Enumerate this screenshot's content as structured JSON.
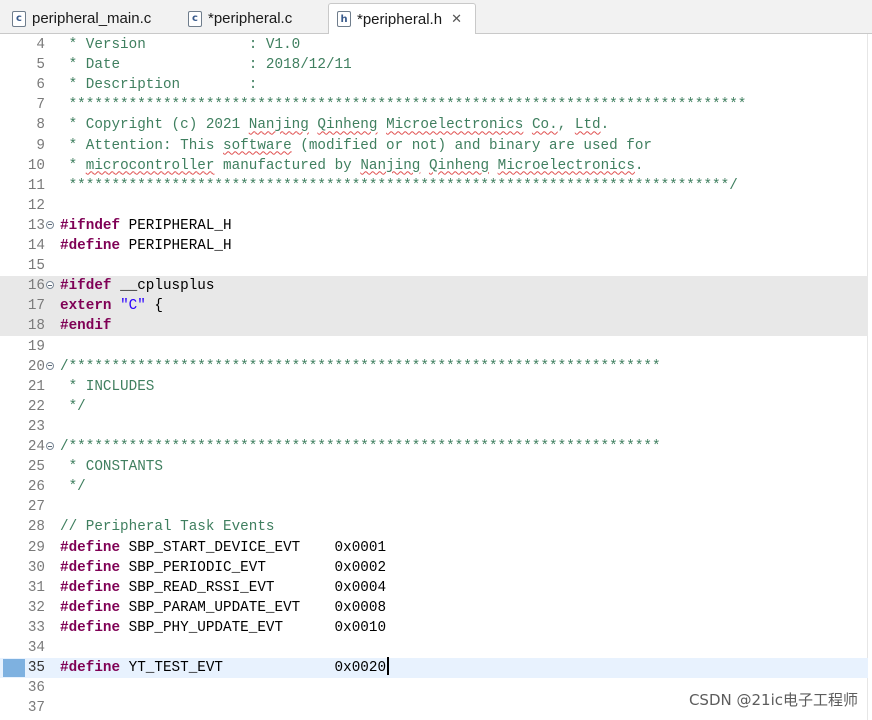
{
  "tabs": [
    {
      "label": "peripheral_main.c",
      "icon": "c-file-icon",
      "icon_text": "c",
      "active": false
    },
    {
      "label": "*peripheral.c",
      "icon": "c-file-icon",
      "icon_text": "c",
      "active": false
    },
    {
      "label": "*peripheral.h",
      "icon": "h-file-icon",
      "icon_text": "h",
      "active": true,
      "closable": true
    }
  ],
  "close_glyph": "✕",
  "editor": {
    "lines": [
      {
        "n": "4",
        "t": [
          [
            "cmt",
            " * Version            : V1.0"
          ]
        ]
      },
      {
        "n": "5",
        "t": [
          [
            "cmt",
            " * Date               : 2018/12/11"
          ]
        ]
      },
      {
        "n": "6",
        "t": [
          [
            "cmt",
            " * Description        :"
          ]
        ]
      },
      {
        "n": "7",
        "t": [
          [
            "cmt",
            " *******************************************************************************"
          ]
        ]
      },
      {
        "n": "8",
        "t": [
          [
            "cmt",
            " * Copyright (c) 2021 "
          ],
          [
            "cmt sq",
            "Nanjing"
          ],
          [
            "cmt",
            " "
          ],
          [
            "cmt sq",
            "Qinheng"
          ],
          [
            "cmt",
            " "
          ],
          [
            "cmt sq",
            "Microelectronics"
          ],
          [
            "cmt",
            " "
          ],
          [
            "cmt sq",
            "Co."
          ],
          [
            "cmt",
            ", "
          ],
          [
            "cmt sq",
            "Ltd"
          ],
          [
            "cmt",
            "."
          ]
        ]
      },
      {
        "n": "9",
        "t": [
          [
            "cmt",
            " * Attention: This "
          ],
          [
            "cmt sq",
            "software"
          ],
          [
            "cmt",
            " (modified or not) and binary are used for"
          ]
        ]
      },
      {
        "n": "10",
        "t": [
          [
            "cmt",
            " * "
          ],
          [
            "cmt sq",
            "microcontroller"
          ],
          [
            "cmt",
            " manufactured by "
          ],
          [
            "cmt sq",
            "Nanjing"
          ],
          [
            "cmt",
            " "
          ],
          [
            "cmt sq",
            "Qinheng"
          ],
          [
            "cmt",
            " "
          ],
          [
            "cmt sq",
            "Microelectronics"
          ],
          [
            "cmt",
            "."
          ]
        ]
      },
      {
        "n": "11",
        "t": [
          [
            "cmt",
            " *****************************************************************************/"
          ]
        ]
      },
      {
        "n": "12",
        "t": []
      },
      {
        "n": "13",
        "fold": true,
        "t": [
          [
            "pp",
            "#ifndef"
          ],
          [
            "id",
            " PERIPHERAL_H"
          ]
        ]
      },
      {
        "n": "14",
        "t": [
          [
            "pp",
            "#define"
          ],
          [
            "id",
            " PERIPHERAL_H"
          ]
        ]
      },
      {
        "n": "15",
        "t": []
      },
      {
        "n": "16",
        "fold": true,
        "block": true,
        "t": [
          [
            "pp",
            "#ifdef"
          ],
          [
            "id",
            " __cplusplus"
          ]
        ]
      },
      {
        "n": "17",
        "block": true,
        "t": [
          [
            "pp",
            "extern"
          ],
          [
            "id",
            " "
          ],
          [
            "str",
            "\"C\""
          ],
          [
            "id",
            " {"
          ]
        ]
      },
      {
        "n": "18",
        "block": true,
        "t": [
          [
            "pp",
            "#endif"
          ]
        ]
      },
      {
        "n": "19",
        "t": []
      },
      {
        "n": "20",
        "fold": true,
        "t": [
          [
            "cmt",
            "/*********************************************************************"
          ]
        ]
      },
      {
        "n": "21",
        "t": [
          [
            "cmt",
            " * INCLUDES"
          ]
        ]
      },
      {
        "n": "22",
        "t": [
          [
            "cmt",
            " */"
          ]
        ]
      },
      {
        "n": "23",
        "t": []
      },
      {
        "n": "24",
        "fold": true,
        "t": [
          [
            "cmt",
            "/*********************************************************************"
          ]
        ]
      },
      {
        "n": "25",
        "t": [
          [
            "cmt",
            " * CONSTANTS"
          ]
        ]
      },
      {
        "n": "26",
        "t": [
          [
            "cmt",
            " */"
          ]
        ]
      },
      {
        "n": "27",
        "t": []
      },
      {
        "n": "28",
        "t": [
          [
            "cmt",
            "// Peripheral Task Events"
          ]
        ]
      },
      {
        "n": "29",
        "t": [
          [
            "pp",
            "#define"
          ],
          [
            "id",
            " SBP_START_DEVICE_EVT    0x0001"
          ]
        ]
      },
      {
        "n": "30",
        "t": [
          [
            "pp",
            "#define"
          ],
          [
            "id",
            " SBP_PERIODIC_EVT        0x0002"
          ]
        ]
      },
      {
        "n": "31",
        "t": [
          [
            "pp",
            "#define"
          ],
          [
            "id",
            " SBP_READ_RSSI_EVT       0x0004"
          ]
        ]
      },
      {
        "n": "32",
        "t": [
          [
            "pp",
            "#define"
          ],
          [
            "id",
            " SBP_PARAM_UPDATE_EVT    0x0008"
          ]
        ]
      },
      {
        "n": "33",
        "t": [
          [
            "pp",
            "#define"
          ],
          [
            "id",
            " SBP_PHY_UPDATE_EVT      0x0010"
          ]
        ]
      },
      {
        "n": "34",
        "t": []
      },
      {
        "n": "35",
        "current": true,
        "marker": true,
        "t": [
          [
            "pp",
            "#define"
          ],
          [
            "id",
            " YT_TEST_EVT             0x0020"
          ]
        ]
      },
      {
        "n": "36",
        "t": []
      },
      {
        "n": "37",
        "t": []
      }
    ]
  },
  "watermark": "CSDN @21ic电子工程师"
}
